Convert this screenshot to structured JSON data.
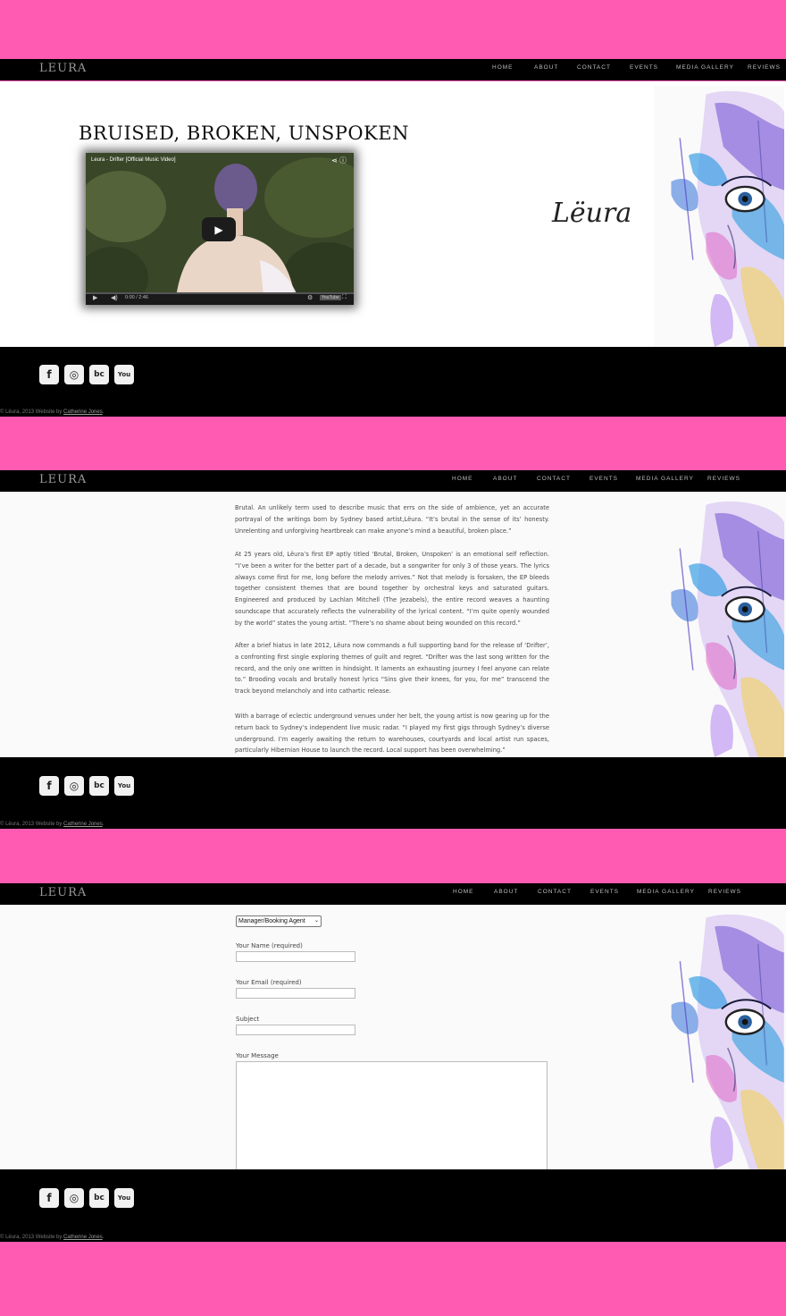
{
  "brand": "LEURA",
  "nav": [
    "HOME",
    "ABOUT",
    "CONTACT",
    "EVENTS",
    "MEDIA GALLERY",
    "REVIEWS"
  ],
  "hero": {
    "title": "BRUISED, BROKEN, UNSPOKEN",
    "script_logo": "Lëura",
    "video": {
      "title": "Leura - Drifter [Official Music Video]",
      "time": "0:00 / 2:46",
      "youtube_label": "YouTube"
    }
  },
  "social": [
    {
      "name": "facebook-icon",
      "glyph": "f"
    },
    {
      "name": "instagram-icon",
      "glyph": "◎"
    },
    {
      "name": "bandcamp-icon",
      "glyph": "bc"
    },
    {
      "name": "youtube-icon",
      "glyph": "You"
    }
  ],
  "footer": {
    "copy_prefix": "© Lëura, 2013 Website by ",
    "copy_link": "Catherine Jones",
    "copy_suffix": "."
  },
  "about": {
    "paragraphs": [
      "Brutal. An unlikely term used to describe music that errs on the side of ambience, yet an accurate portrayal of the writings born by Sydney based artist,Lëura. “It’s brutal in the sense of its’ honesty. Unrelenting and unforgiving heartbreak can make anyone’s mind a beautiful, broken place.”",
      "At 25 years old, Lëura’s first EP aptly titled ‘Brutal, Broken, Unspoken’ is an emotional self reflection. “I’ve been a writer for the better part of a decade, but a songwriter for only 3 of those years. The lyrics always come first for me, long before the melody arrives.” Not that melody is forsaken, the EP bleeds together consistent themes that are bound together by orchestral keys and saturated guitars. Engineered and produced by Lachlan Mitchell (The Jezabels), the entire record weaves a haunting soundscape that accurately reflects the vulnerability of the lyrical content. “I’m quite openly wounded by the world” states the young artist. “There’s no shame about being wounded on this record.”",
      "After a brief hiatus in late 2012, Lëura now commands a full supporting band for the release of ‘Drifter’, a confronting first single exploring themes of guilt and regret. “Drifter was the last song written for the record, and the only one written in hindsight. It laments an exhausting journey I feel anyone can relate to.” Brooding vocals and brutally honest lyrics “Sins give their knees, for you, for me” transcend the track beyond melancholy and into cathartic release.",
      "With a barrage of eclectic underground venues under her belt, the young artist is now gearing up for the return back to Sydney’s independent live music radar. “I played my first gigs through Sydney’s diverse underground. I’m eagerly awaiting the return to warehouses, courtyards and local artist run spaces, particularly Hibernian House to launch the record. Local support has been overwhelming.”"
    ]
  },
  "contact": {
    "select_value": "Manager/Booking Agent",
    "name_label": "Your Name (required)",
    "email_label": "Your Email (required)",
    "subject_label": "Subject",
    "message_label": "Your Message"
  },
  "colors": {
    "accent": "#ff5bb3",
    "nav_bg": "#000000",
    "content_bg": "#fafafa"
  }
}
